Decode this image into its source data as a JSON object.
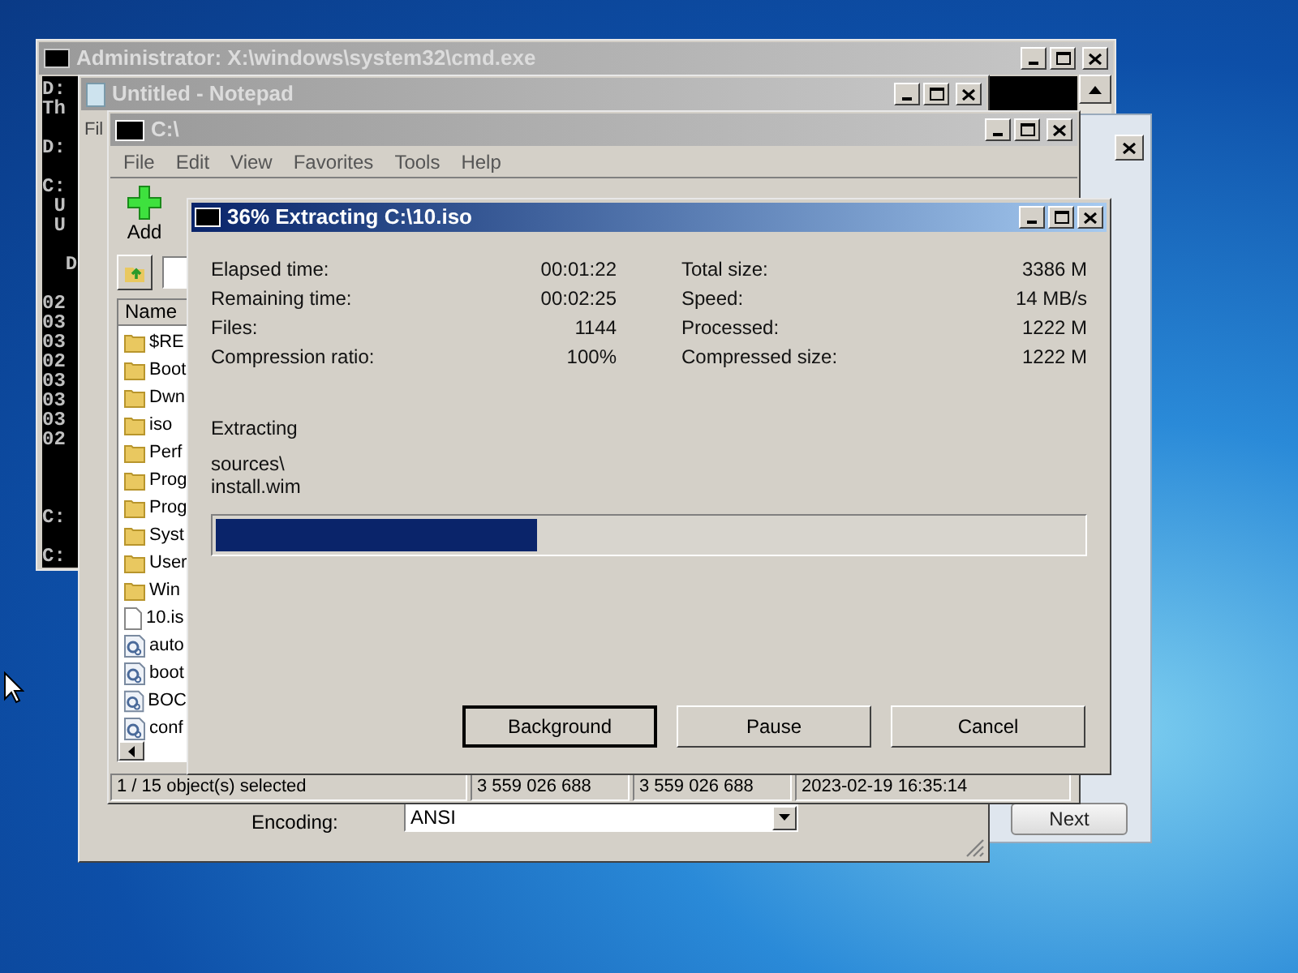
{
  "console_window": {
    "title": "Administrator: X:\\windows\\system32\\cmd.exe",
    "blocks": [
      [
        "D:",
        "Th"
      ],
      [
        "D:"
      ],
      [
        "C:",
        " U",
        " U"
      ],
      [
        "  D"
      ],
      [
        "02",
        "03",
        "03",
        "02",
        "03",
        "03",
        "03",
        "02"
      ],
      [
        "C:"
      ],
      [
        "C:"
      ]
    ]
  },
  "setup_window": {
    "next_button": "Next"
  },
  "notepad_window": {
    "title": "Untitled - Notepad",
    "menu_first": "Fil",
    "encoding_label": "Encoding:",
    "encoding_value": "ANSI"
  },
  "archive_window": {
    "title": "C:\\",
    "menu": [
      "File",
      "Edit",
      "View",
      "Favorites",
      "Tools",
      "Help"
    ],
    "toolbar": [
      "Add"
    ],
    "column": "Name",
    "files": [
      {
        "name": "$RE",
        "kind": "folder"
      },
      {
        "name": "Boot",
        "kind": "folder"
      },
      {
        "name": "Dwn",
        "kind": "folder"
      },
      {
        "name": "iso",
        "kind": "folder"
      },
      {
        "name": "Perf",
        "kind": "folder"
      },
      {
        "name": "Prog",
        "kind": "folder"
      },
      {
        "name": "Prog",
        "kind": "folder"
      },
      {
        "name": "Syst",
        "kind": "folder"
      },
      {
        "name": "User",
        "kind": "folder"
      },
      {
        "name": "Win",
        "kind": "folder"
      },
      {
        "name": "10.is",
        "kind": "file"
      },
      {
        "name": "auto",
        "kind": "config"
      },
      {
        "name": "boot",
        "kind": "config"
      },
      {
        "name": "BOC",
        "kind": "config"
      },
      {
        "name": "conf",
        "kind": "config"
      }
    ],
    "status_bar": [
      "1 / 15 object(s) selected",
      "3 559 026 688",
      "3 559 026 688",
      "2023-02-19 16:35:14"
    ]
  },
  "progress_dialog": {
    "title": "36% Extracting C:\\10.iso",
    "stats_left": [
      {
        "label": "Elapsed time:",
        "value": "00:01:22"
      },
      {
        "label": "Remaining time:",
        "value": "00:02:25"
      },
      {
        "label": "Files:",
        "value": "1144"
      },
      {
        "label": "Compression ratio:",
        "value": "100%"
      }
    ],
    "stats_right": [
      {
        "label": "Total size:",
        "value": "3386 M"
      },
      {
        "label": "Speed:",
        "value": "14 MB/s"
      },
      {
        "label": "Processed:",
        "value": "1222 M"
      },
      {
        "label": "Compressed size:",
        "value": "1222 M"
      }
    ],
    "operation": "Extracting",
    "current_path": "sources\\",
    "current_file": "install.wim",
    "level": 0.37,
    "buttons": [
      {
        "label": "Background",
        "default": true
      },
      {
        "label": "Pause",
        "default": false
      },
      {
        "label": "Cancel",
        "default": false
      }
    ]
  }
}
